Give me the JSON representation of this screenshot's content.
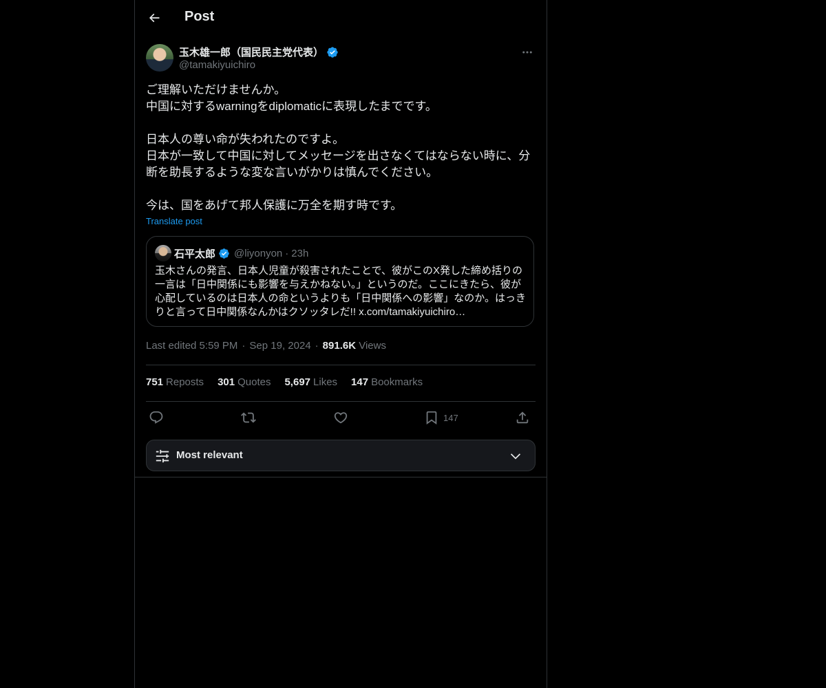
{
  "header": {
    "title": "Post"
  },
  "author": {
    "name": "玉木雄一郎（国民民主党代表）",
    "handle": "@tamakiyuichiro"
  },
  "tweet": {
    "text": "ご理解いただけませんか。\n中国に対するwarningをdiplomaticに表現したまでです。\n\n日本人の尊い命が失われたのですよ。\n日本が一致して中国に対してメッセージを出さなくてはならない時に、分断を助長するような変な言いがかりは慎んでください。\n\n今は、国をあげて邦人保護に万全を期す時です。",
    "translate_label": "Translate post"
  },
  "quote": {
    "name": "石平太郎",
    "handle": "@liyonyon",
    "separator": "·",
    "time": "23h",
    "text": "玉木さんの発言、日本人児童が殺害されたことで、彼がこのX発した締め括りの一言は「日中関係にも影響を与えかねない。」というのだ。ここにきたら、彼が心配しているのは日本人の命というよりも「日中関係への影響」なのか。はっきりと言って日中関係なんかはクソッタレだ!! x.com/tamakiyuichiro…"
  },
  "meta": {
    "edited": "Last edited 5:59 PM",
    "sep1": "·",
    "date": "Sep 19, 2024",
    "sep2": "·",
    "views_count": "891.6K",
    "views_label": "Views"
  },
  "stats": [
    {
      "count": "751",
      "label": "Reposts"
    },
    {
      "count": "301",
      "label": "Quotes"
    },
    {
      "count": "5,697",
      "label": "Likes"
    },
    {
      "count": "147",
      "label": "Bookmarks"
    }
  ],
  "actions": {
    "bookmark_count": "147"
  },
  "sort": {
    "label": "Most relevant"
  },
  "colors": {
    "accent": "#1d9bf0",
    "background": "#000000",
    "muted": "#71767b",
    "border": "#2f3336"
  }
}
